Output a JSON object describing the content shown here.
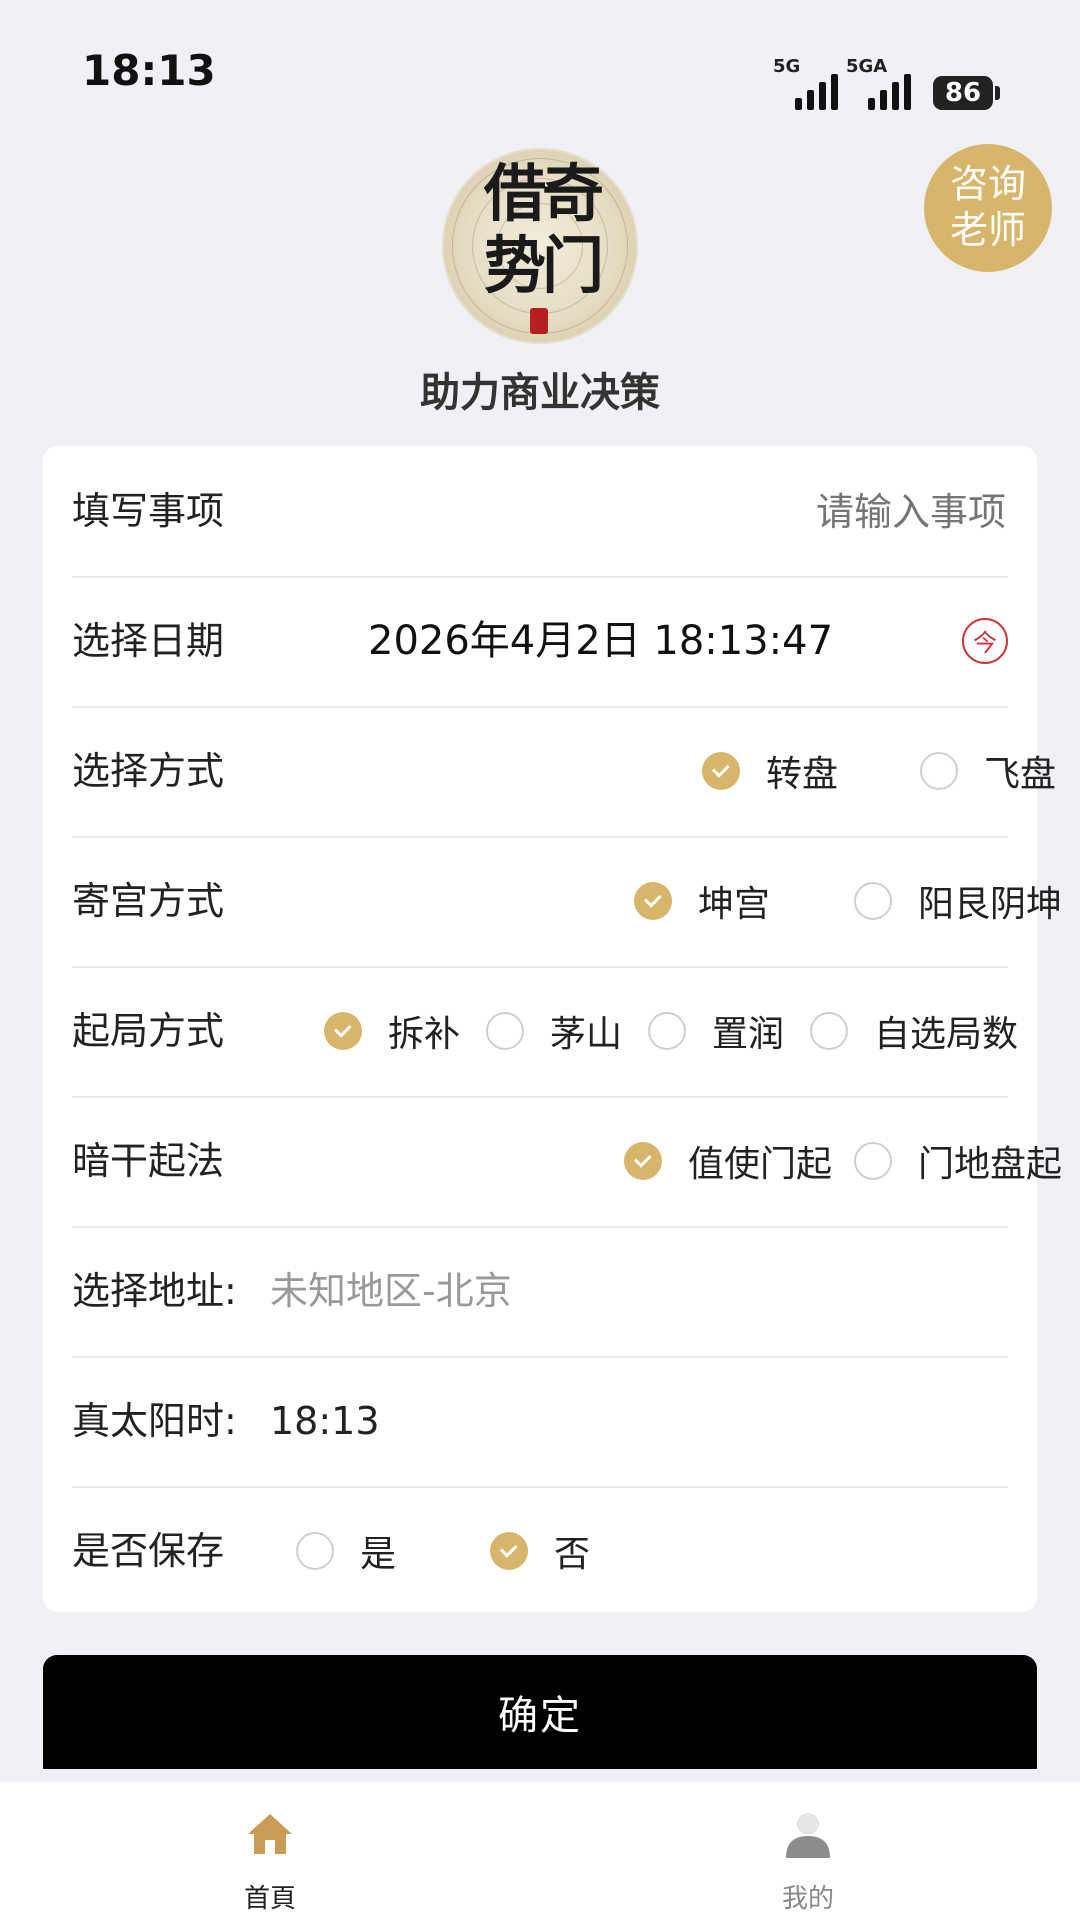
{
  "status_bar": {
    "time": "18:13",
    "sim1_label": "5G",
    "sim2_label": "5GA",
    "battery": "86"
  },
  "header": {
    "logo_text": "借奇势门",
    "slogan": "助力商业决策",
    "consult_line1": "咨询",
    "consult_line2": "老师"
  },
  "form": {
    "matter": {
      "label": "填写事项",
      "placeholder": "请输入事项"
    },
    "date": {
      "label": "选择日期",
      "value": "2026年4月2日 18:13:47",
      "today_glyph": "今"
    },
    "method": {
      "label": "选择方式",
      "options": [
        "转盘",
        "飞盘"
      ],
      "selected": 0
    },
    "palace": {
      "label": "寄宫方式",
      "options": [
        "坤宫",
        "阳艮阴坤"
      ],
      "selected": 0
    },
    "start": {
      "label": "起局方式",
      "options": [
        "拆补",
        "茅山",
        "置润",
        "自选局数"
      ],
      "selected": 0
    },
    "hidden_stem": {
      "label": "暗干起法",
      "options": [
        "值使门起",
        "门地盘起"
      ],
      "selected": 0
    },
    "address": {
      "label": "选择地址:",
      "value": "未知地区-北京"
    },
    "solar_time": {
      "label": "真太阳时:",
      "value": "18:13"
    },
    "save": {
      "label": "是否保存",
      "options": [
        "是",
        "否"
      ],
      "selected": 1
    }
  },
  "confirm_label": "确定",
  "tabs": [
    {
      "label": "首頁",
      "icon": "home-icon",
      "active": true,
      "color": "#222222"
    },
    {
      "label": "我的",
      "icon": "user-icon",
      "active": false,
      "color": "#888888"
    }
  ],
  "colors": {
    "accent": "#d7b56a",
    "today_red": "#c9353a"
  }
}
